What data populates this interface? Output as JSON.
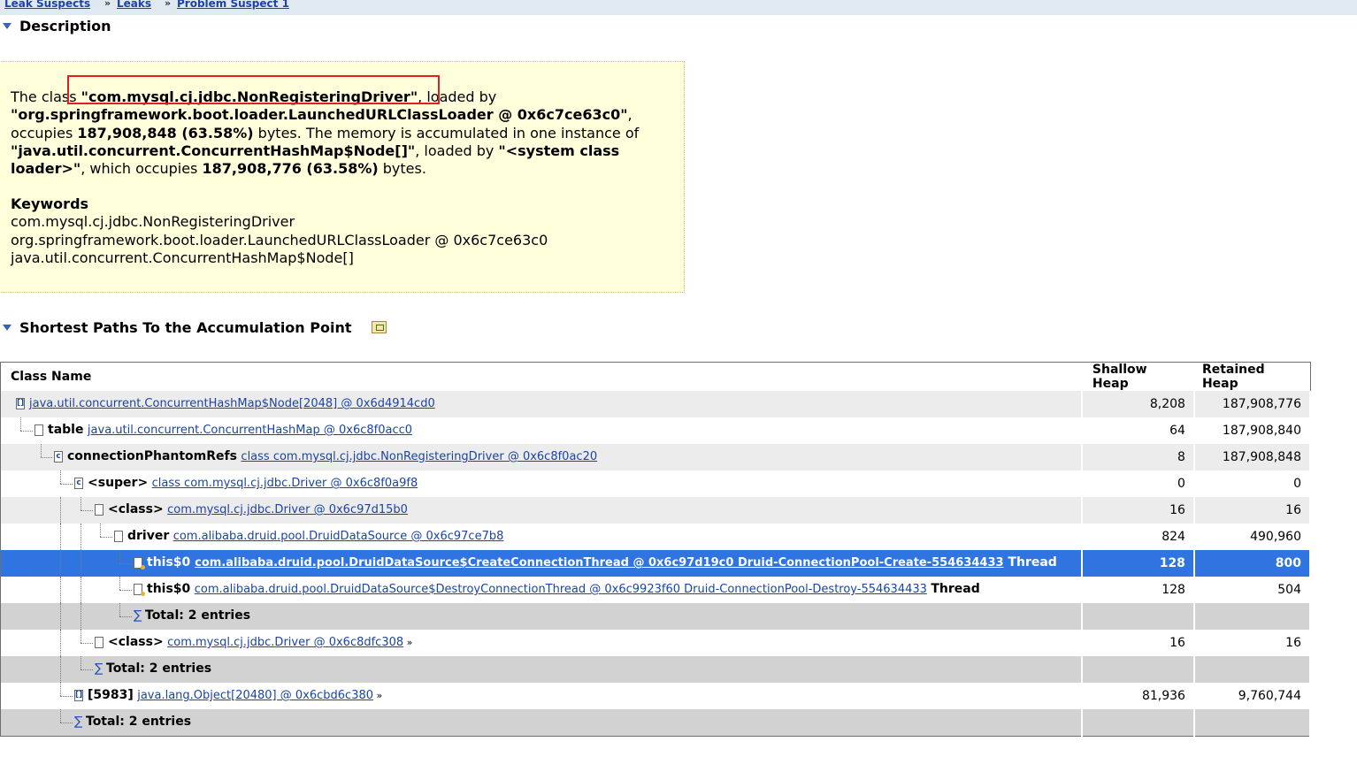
{
  "breadcrumb": [
    "Leak Suspects",
    "Leaks",
    "Problem Suspect 1"
  ],
  "breadcrumb_sep": "»",
  "description": {
    "title": "Description",
    "p1": "The class ",
    "class_name": "\"com.mysql.cj.jdbc.NonRegisteringDriver\"",
    "p2": ", loaded by ",
    "loader": "\"org.springframework.boot.loader.LaunchedURLClassLoader @ 0x6c7ce63c0\"",
    "p3": ", occupies ",
    "occupies": "187,908,848 (63.58%)",
    "p4": " bytes. The memory is accumulated in one instance of ",
    "instance": "\"java.util.concurrent.ConcurrentHashMap$Node[]\"",
    "p5": ", loaded by ",
    "instance_loader": "\"<system class loader>\"",
    "p6": ", which occupies ",
    "instance_occupies": "187,908,776 (63.58%)",
    "p7": " bytes.",
    "keywords_title": "Keywords",
    "keywords": [
      "com.mysql.cj.jdbc.NonRegisteringDriver",
      "org.springframework.boot.loader.LaunchedURLClassLoader @ 0x6c7ce63c0",
      "java.util.concurrent.ConcurrentHashMap$Node[]"
    ]
  },
  "paths": {
    "title": "Shortest Paths To the Accumulation Point",
    "columns": [
      "Class Name",
      "Shallow Heap",
      "Retained Heap"
    ],
    "rows": [
      {
        "field": "",
        "link": "java.util.concurrent.ConcurrentHashMap$Node[2048] @ 0x6d4914cd0",
        "suffix": "",
        "more": "",
        "shallow": "8,208",
        "retained": "187,908,776",
        "icon": "array"
      },
      {
        "field": "table",
        "link": "java.util.concurrent.ConcurrentHashMap @ 0x6c8f0acc0",
        "suffix": "",
        "more": "",
        "shallow": "64",
        "retained": "187,908,840",
        "icon": "object"
      },
      {
        "field": "connectionPhantomRefs",
        "link": "class com.mysql.cj.jdbc.NonRegisteringDriver @ 0x6c8f0ac20",
        "suffix": "",
        "more": "",
        "shallow": "8",
        "retained": "187,908,848",
        "icon": "class"
      },
      {
        "field": "<super>",
        "link": "class com.mysql.cj.jdbc.Driver @ 0x6c8f0a9f8",
        "suffix": "",
        "more": "",
        "shallow": "0",
        "retained": "0",
        "icon": "class"
      },
      {
        "field": "<class>",
        "link": "com.mysql.cj.jdbc.Driver @ 0x6c97d15b0",
        "suffix": "",
        "more": "",
        "shallow": "16",
        "retained": "16",
        "icon": "object"
      },
      {
        "field": "driver",
        "link": "com.alibaba.druid.pool.DruidDataSource @ 0x6c97ce7b8",
        "suffix": "",
        "more": "",
        "shallow": "824",
        "retained": "490,960",
        "icon": "object"
      },
      {
        "field": "this$0",
        "link": "com.alibaba.druid.pool.DruidDataSource$CreateConnectionThread @ 0x6c97d19c0 Druid-ConnectionPool-Create-554634433",
        "suffix": "Thread",
        "more": "",
        "shallow": "128",
        "retained": "800",
        "icon": "thread"
      },
      {
        "field": "this$0",
        "link": "com.alibaba.druid.pool.DruidDataSource$DestroyConnectionThread @ 0x6c9923f60 Druid-ConnectionPool-Destroy-554634433",
        "suffix": "Thread",
        "more": "",
        "shallow": "128",
        "retained": "504",
        "icon": "thread"
      },
      {
        "field": "Total: 2 entries",
        "link": "",
        "suffix": "",
        "more": "",
        "shallow": "",
        "retained": "",
        "icon": "sigma"
      },
      {
        "field": "<class>",
        "link": "com.mysql.cj.jdbc.Driver @ 0x6c8dfc308",
        "suffix": "",
        "more": "»",
        "shallow": "16",
        "retained": "16",
        "icon": "object"
      },
      {
        "field": "Total: 2 entries",
        "link": "",
        "suffix": "",
        "more": "",
        "shallow": "",
        "retained": "",
        "icon": "sigma"
      },
      {
        "field": "[5983]",
        "link": "java.lang.Object[20480] @ 0x6cbd6c380",
        "suffix": "",
        "more": "»",
        "shallow": "81,936",
        "retained": "9,760,744",
        "icon": "array"
      },
      {
        "field": "Total: 2 entries",
        "link": "",
        "suffix": "",
        "more": "",
        "shallow": "",
        "retained": "",
        "icon": "sigma"
      }
    ]
  }
}
